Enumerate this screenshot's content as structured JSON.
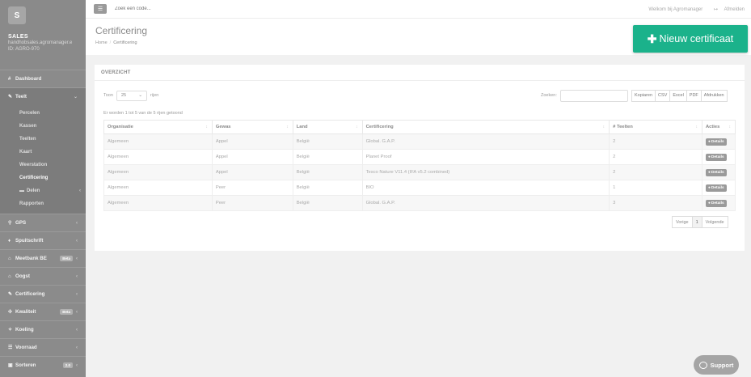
{
  "app": {
    "logo_letter": "S",
    "title": "SALES",
    "subtitle_email": "handhobsales.agromanager.e",
    "subtitle_id": "ID: AGRO-970"
  },
  "topbar": {
    "search_placeholder": "Zoek een code...",
    "welcome": "Welkom bij Agromanager",
    "logout": "Afmelden"
  },
  "sidebar": {
    "items": [
      {
        "label": "Dashboard",
        "icon": "#"
      },
      {
        "label": "Teelt",
        "icon": "✎",
        "open": true
      },
      {
        "label": "GPS",
        "icon": "⚲"
      },
      {
        "label": "Spuitschrift",
        "icon": "♦"
      },
      {
        "label": "Meetbank BE",
        "icon": "⌂",
        "badge": "Beta"
      },
      {
        "label": "Oogst",
        "icon": "⌂"
      },
      {
        "label": "Certificering",
        "icon": "✎"
      },
      {
        "label": "Kwaliteit",
        "icon": "✣",
        "badge": "Beta"
      },
      {
        "label": "Koeling",
        "icon": "✧"
      },
      {
        "label": "Voorraad",
        "icon": "☰"
      },
      {
        "label": "Sorteren",
        "icon": "▣",
        "badge": "2.0"
      }
    ],
    "subitems": [
      {
        "label": "Percelen"
      },
      {
        "label": "Kassen"
      },
      {
        "label": "Teelten"
      },
      {
        "label": "Kaart"
      },
      {
        "label": "Weerstation"
      },
      {
        "label": "Certificering",
        "active": true
      },
      {
        "label": "Delen",
        "icon": "▬"
      },
      {
        "label": "Rapporten"
      }
    ]
  },
  "page": {
    "title": "Certificering",
    "breadcrumb_home": "Home",
    "breadcrumb_current": "Certificering",
    "new_button": "Nieuw certificaat"
  },
  "panel": {
    "heading": "OVERZICHT",
    "show_label": "Toon",
    "length_value": "25",
    "rows_label": "rijen",
    "search_label": "Zoeken:",
    "export_buttons": [
      "Kopiaren",
      "CSV",
      "Excel",
      "PDF",
      "Afdrukken"
    ],
    "info": "Er worden 1 tot 5 van de 5 rijen getoond",
    "columns": [
      "Organisatie",
      "Gewas",
      "Land",
      "Certificering",
      "# Teelten",
      "Acties"
    ],
    "rows": [
      [
        "Algemeen",
        "Appel",
        "België",
        "Global. G.A.P.",
        "2"
      ],
      [
        "Algemeen",
        "Appel",
        "België",
        "Planet Proof",
        "2"
      ],
      [
        "Algemeen",
        "Appel",
        "België",
        "Tesco Nature V11.4 (IFA v5.2 combined)",
        "2"
      ],
      [
        "Algemeen",
        "Peer",
        "België",
        "BIO",
        "1"
      ],
      [
        "Algemeen",
        "Peer",
        "België",
        "Global. G.A.P.",
        "3"
      ]
    ],
    "details_label": "Details",
    "pager": {
      "prev": "Vorige",
      "page": "1",
      "next": "Volgende"
    }
  },
  "support_label": "Support"
}
